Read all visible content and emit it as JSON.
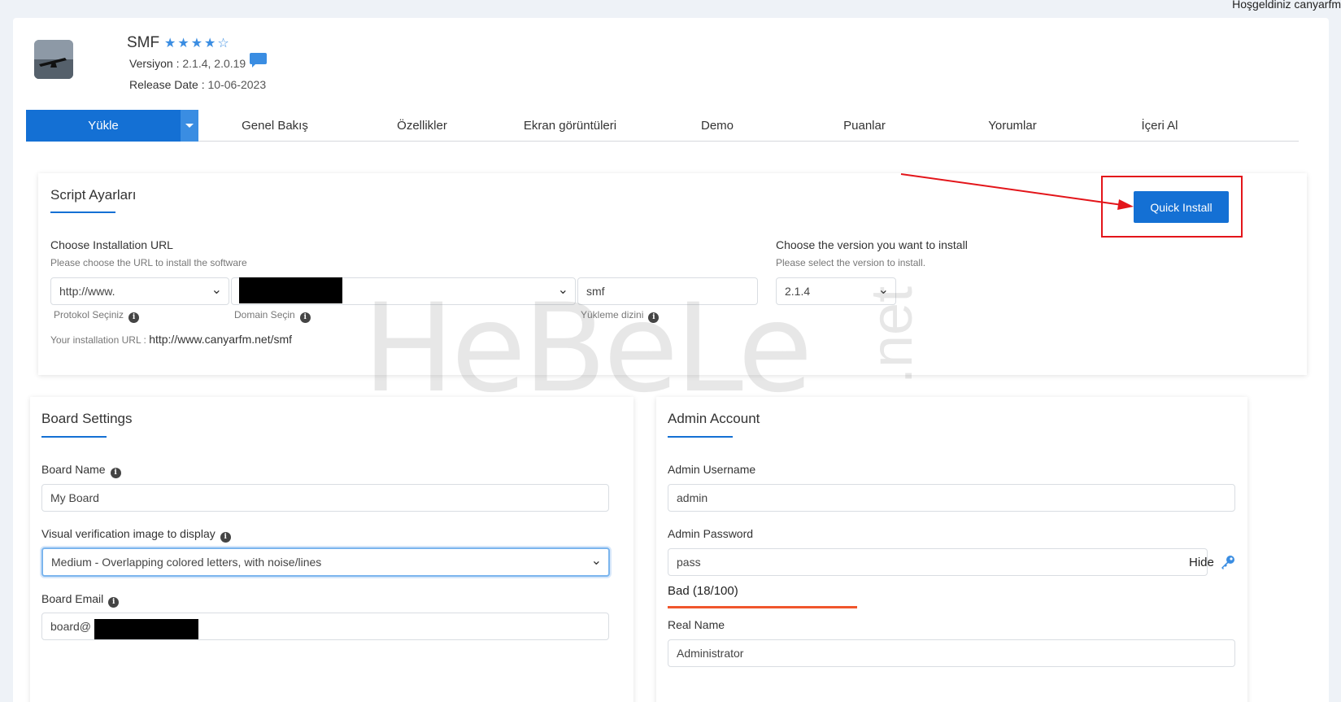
{
  "header": {
    "welcome_text": "Hoşgeldiniz canyarfm",
    "app_name": "SMF",
    "stars": "★★★★☆",
    "version_label": "Versiyon :",
    "version_value": "2.1.4, 2.0.19",
    "release_label": "Release Date :",
    "release_value": "10-06-2023"
  },
  "tabs": [
    {
      "label": "Yükle"
    },
    {
      "label": "Genel Bakış"
    },
    {
      "label": "Özellikler"
    },
    {
      "label": "Ekran görüntüleri"
    },
    {
      "label": "Demo"
    },
    {
      "label": "Puanlar"
    },
    {
      "label": "Yorumlar"
    },
    {
      "label": "İçeri Al"
    }
  ],
  "script_settings": {
    "title": "Script Ayarları",
    "quick_install_label": "Quick Install",
    "install_url_label": "Choose Installation URL",
    "install_url_hint": "Please choose the URL to install the software",
    "protocol_value": "http://www.",
    "protocol_label": "Protokol Seçiniz",
    "domain_label": "Domain Seçin",
    "directory_value": "smf",
    "directory_label": "Yükleme dizini",
    "your_url_label": "Your installation URL :",
    "your_url_value": "http://www.canyarfm.net/smf",
    "version_label": "Choose the version you want to install",
    "version_hint": "Please select the version to install.",
    "version_value": "2.1.4"
  },
  "board_settings": {
    "title": "Board Settings",
    "board_name_label": "Board Name",
    "board_name_value": "My Board",
    "verification_label": "Visual verification image to display",
    "verification_value": "Medium - Overlapping colored letters, with noise/lines",
    "board_email_label": "Board Email",
    "board_email_value": "board@"
  },
  "admin_account": {
    "title": "Admin Account",
    "username_label": "Admin Username",
    "username_value": "admin",
    "password_label": "Admin Password",
    "password_value": "pass",
    "hide_label": "Hide",
    "strength_text": "Bad (18/100)",
    "strength_fraction": 0.18,
    "real_name_label": "Real Name",
    "real_name_value": "Administrator"
  },
  "watermark": {
    "text": "HeBeLe",
    "suffix": ".net"
  },
  "colors": {
    "primary": "#1470d4",
    "star": "#3a8de2",
    "highlight": "#e3151a",
    "strength_bad": "#f0562c"
  }
}
